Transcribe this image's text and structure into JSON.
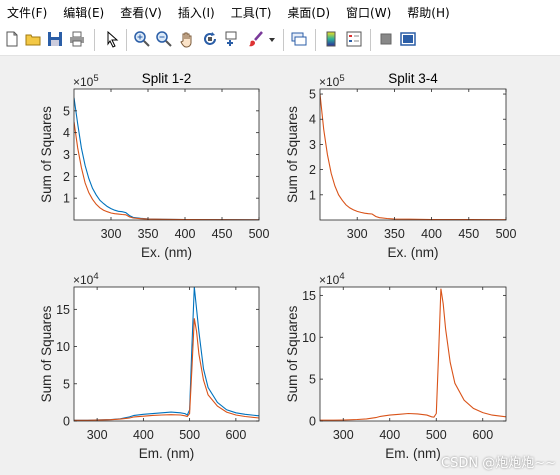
{
  "menu": [
    "文件(F)",
    "编辑(E)",
    "查看(V)",
    "插入(I)",
    "工具(T)",
    "桌面(D)",
    "窗口(W)",
    "帮助(H)"
  ],
  "toolbar_icons": [
    "new-file-icon",
    "open-folder-icon",
    "save-icon",
    "print-icon",
    "pointer-icon",
    "zoom-in-icon",
    "zoom-out-icon",
    "pan-hand-icon",
    "rotate-3d-icon",
    "data-cursor-icon",
    "brush-icon",
    "brush-dropdown-icon",
    "link-plot-icon",
    "colorbar-icon",
    "legend-icon",
    "hide-plot-tools-icon",
    "show-plot-tools-icon"
  ],
  "colors": {
    "series1": "#0072bd",
    "series2": "#d95319"
  },
  "watermark": "CSDN @炮炮炮~~",
  "chart_data": [
    {
      "type": "line",
      "title": "Split 1-2",
      "xlabel": "Ex. (nm)",
      "ylabel": "Sum of Squares",
      "exponent": "×10",
      "exponent_power": "5",
      "xlim": [
        250,
        500
      ],
      "ylim": [
        0,
        6
      ],
      "xticks": [
        "300",
        "350",
        "400",
        "450",
        "500"
      ],
      "yticks": [
        "1",
        "2",
        "3",
        "4",
        "5"
      ],
      "series": [
        {
          "color": "#0072bd",
          "x": [
            250,
            255,
            260,
            265,
            270,
            275,
            280,
            285,
            290,
            295,
            300,
            305,
            310,
            315,
            320,
            325,
            330,
            340,
            350,
            370,
            400,
            450,
            500
          ],
          "y": [
            5.6,
            4.4,
            3.3,
            2.5,
            1.9,
            1.45,
            1.15,
            0.9,
            0.75,
            0.62,
            0.52,
            0.45,
            0.4,
            0.38,
            0.34,
            0.2,
            0.12,
            0.08,
            0.05,
            0.03,
            0.02,
            0.015,
            0.01
          ]
        },
        {
          "color": "#d95319",
          "x": [
            250,
            255,
            260,
            265,
            270,
            275,
            280,
            285,
            290,
            295,
            300,
            305,
            310,
            315,
            320,
            325,
            330,
            340,
            350,
            370,
            400,
            450,
            500
          ],
          "y": [
            4.5,
            3.3,
            2.4,
            1.7,
            1.25,
            0.95,
            0.72,
            0.56,
            0.45,
            0.38,
            0.32,
            0.29,
            0.27,
            0.25,
            0.24,
            0.14,
            0.09,
            0.06,
            0.04,
            0.03,
            0.02,
            0.015,
            0.01
          ]
        }
      ]
    },
    {
      "type": "line",
      "title": "Split 3-4",
      "xlabel": "Ex. (nm)",
      "ylabel": "Sum of Squares",
      "exponent": "×10",
      "exponent_power": "5",
      "xlim": [
        250,
        500
      ],
      "ylim": [
        0,
        5.2
      ],
      "xticks": [
        "300",
        "350",
        "400",
        "450",
        "500"
      ],
      "yticks": [
        "1",
        "2",
        "3",
        "4",
        "5"
      ],
      "series": [
        {
          "color": "#d95319",
          "x": [
            250,
            255,
            260,
            265,
            270,
            275,
            280,
            285,
            290,
            295,
            300,
            305,
            310,
            315,
            320,
            325,
            330,
            340,
            350,
            370,
            400,
            450,
            500
          ],
          "y": [
            5.0,
            3.6,
            2.6,
            1.85,
            1.35,
            1.0,
            0.78,
            0.6,
            0.48,
            0.4,
            0.34,
            0.3,
            0.27,
            0.25,
            0.24,
            0.14,
            0.09,
            0.06,
            0.04,
            0.03,
            0.02,
            0.015,
            0.01
          ]
        }
      ]
    },
    {
      "type": "line",
      "title": "",
      "xlabel": "Em. (nm)",
      "ylabel": "Sum of Squares",
      "exponent": "×10",
      "exponent_power": "4",
      "xlim": [
        250,
        650
      ],
      "ylim": [
        0,
        18
      ],
      "xticks": [
        "300",
        "400",
        "500",
        "600"
      ],
      "yticks": [
        "0",
        "5",
        "10",
        "15"
      ],
      "series": [
        {
          "color": "#0072bd",
          "x": [
            250,
            280,
            300,
            330,
            350,
            370,
            380,
            400,
            420,
            440,
            460,
            480,
            490,
            495,
            500,
            505,
            510,
            515,
            520,
            530,
            540,
            560,
            580,
            600,
            620,
            650
          ],
          "y": [
            0.1,
            0.1,
            0.15,
            0.2,
            0.3,
            0.55,
            0.75,
            0.9,
            1.0,
            1.1,
            1.2,
            1.1,
            1.0,
            0.8,
            1.5,
            10,
            18,
            15,
            12,
            7,
            4.5,
            2.5,
            1.5,
            1.1,
            0.9,
            0.7
          ]
        },
        {
          "color": "#d95319",
          "x": [
            250,
            280,
            300,
            330,
            350,
            370,
            380,
            400,
            420,
            440,
            460,
            480,
            490,
            495,
            500,
            505,
            510,
            515,
            520,
            530,
            540,
            560,
            580,
            600,
            620,
            650
          ],
          "y": [
            0.1,
            0.1,
            0.12,
            0.18,
            0.25,
            0.4,
            0.55,
            0.65,
            0.75,
            0.8,
            0.85,
            0.8,
            0.7,
            0.6,
            1.0,
            7,
            13.8,
            12,
            9,
            5.5,
            3.5,
            2,
            1.2,
            0.8,
            0.6,
            0.4
          ]
        }
      ]
    },
    {
      "type": "line",
      "title": "",
      "xlabel": "Em. (nm)",
      "ylabel": "Sum of Squares",
      "exponent": "×10",
      "exponent_power": "4",
      "xlim": [
        250,
        650
      ],
      "ylim": [
        0,
        16
      ],
      "xticks": [
        "300",
        "400",
        "500",
        "600"
      ],
      "yticks": [
        "0",
        "5",
        "10",
        "15"
      ],
      "series": [
        {
          "color": "#d95319",
          "x": [
            250,
            280,
            300,
            330,
            350,
            370,
            380,
            400,
            420,
            440,
            460,
            480,
            490,
            495,
            500,
            505,
            510,
            515,
            520,
            530,
            540,
            560,
            580,
            600,
            620,
            650
          ],
          "y": [
            0.1,
            0.1,
            0.12,
            0.18,
            0.25,
            0.4,
            0.55,
            0.7,
            0.8,
            0.9,
            0.85,
            0.7,
            0.5,
            0.45,
            0.9,
            8,
            15.8,
            14,
            11,
            7,
            4.5,
            2.5,
            1.5,
            1.0,
            0.7,
            0.5
          ]
        }
      ]
    }
  ]
}
